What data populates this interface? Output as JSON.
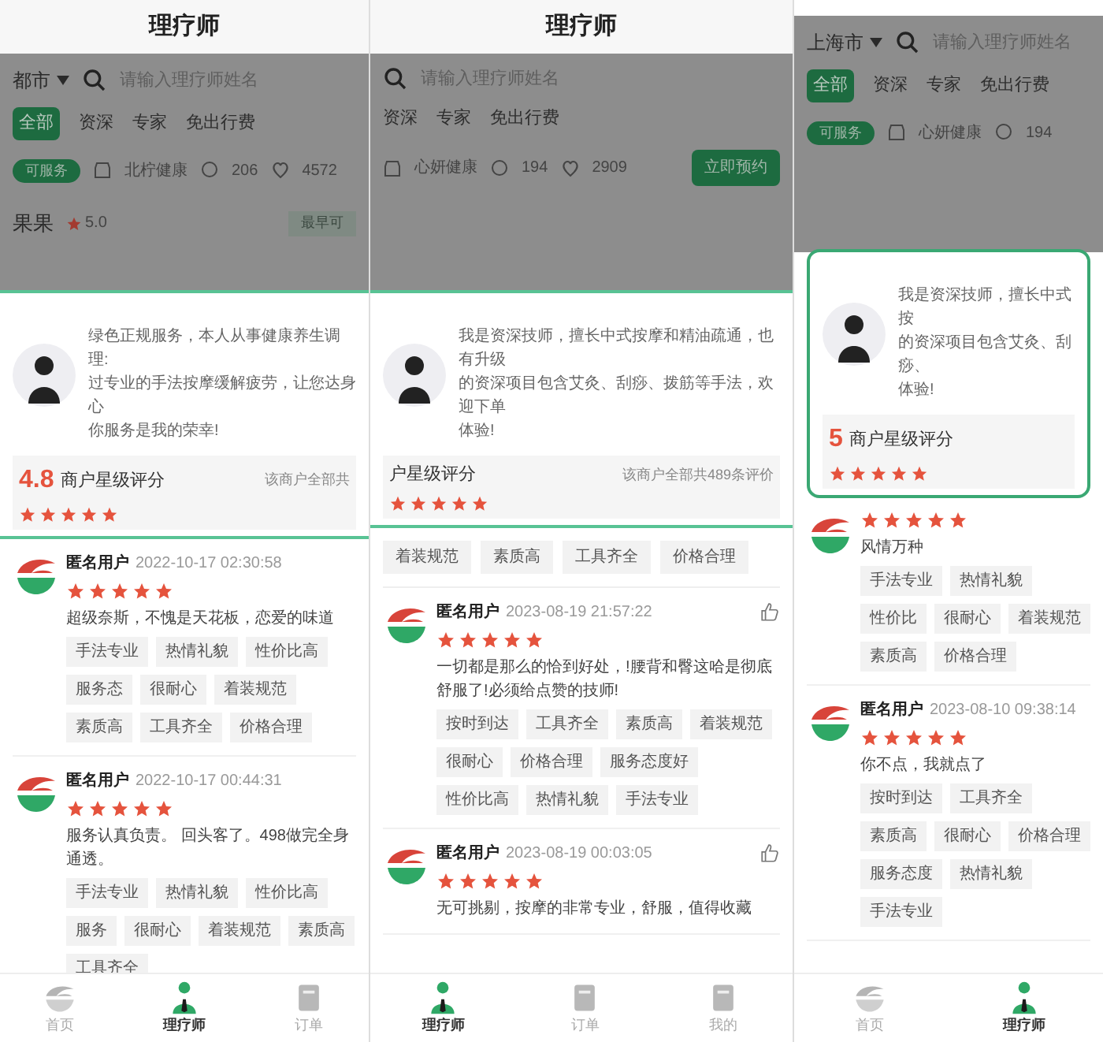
{
  "panels": [
    {
      "title": "理疗师",
      "city": "都市",
      "search": {
        "placeholder": "请输入理疗师姓名"
      },
      "tabs": [
        {
          "label": "全部",
          "selected": true
        },
        {
          "label": "资深",
          "selected": false
        },
        {
          "label": "专家",
          "selected": false
        },
        {
          "label": "免出行费",
          "selected": false
        }
      ],
      "listing": {
        "badge": "可服务",
        "shop": "北柠健康",
        "comments": "206",
        "likes": "4572",
        "name": "果果",
        "rating": "5.0",
        "tag": "最早可"
      },
      "profile": {
        "intro": [
          "绿色正规服务，本人从事健康养生调理:",
          "过专业的手法按摩缓解疲劳，让您达身心",
          "你服务是我的荣幸!"
        ],
        "score": "4.8",
        "score_label": "商户星级评分",
        "total": "该商户全部共",
        "stars": 5
      },
      "reviews": [
        {
          "user": "匿名用户",
          "time": "2022-10-17 02:30:58",
          "stars": 5,
          "text": "超级奈斯，不愧是天花板，恋爱的味道",
          "tags": [
            "手法专业",
            "热情礼貌",
            "性价比高",
            "服务态",
            "很耐心",
            "着装规范",
            "素质高",
            "工具齐全",
            "价格合理"
          ]
        },
        {
          "user": "匿名用户",
          "time": "2022-10-17 00:44:31",
          "stars": 5,
          "text": "服务认真负责。 回头客了。498做完全身通透。",
          "tags": [
            "手法专业",
            "热情礼貌",
            "性价比高",
            "服务",
            "很耐心",
            "着装规范",
            "素质高",
            "工具齐全"
          ]
        }
      ],
      "nav": [
        {
          "label": "首页",
          "selected": false
        },
        {
          "label": "理疗师",
          "selected": true
        },
        {
          "label": "订单",
          "selected": false
        }
      ]
    },
    {
      "title": "理疗师",
      "search": {
        "placeholder": "请输入理疗师姓名"
      },
      "tabs": [
        {
          "label": "资深",
          "selected": false
        },
        {
          "label": "专家",
          "selected": false
        },
        {
          "label": "免出行费",
          "selected": false
        }
      ],
      "listing": {
        "shop": "心妍健康",
        "comments": "194",
        "likes": "2909",
        "button": "立即预约"
      },
      "profile": {
        "intro": [
          "我是资深技师，擅长中式按摩和精油疏通，也有升级",
          "的资深项目包含艾灸、刮痧、拨筋等手法，欢迎下单",
          "体验!"
        ],
        "score_label": "户星级评分",
        "total": "该商户全部共489条评价",
        "stars": 5
      },
      "leading_tags": [
        "着装规范",
        "素质高",
        "工具齐全",
        "价格合理"
      ],
      "reviews": [
        {
          "user": "匿名用户",
          "time": "2023-08-19 21:57:22",
          "stars": 5,
          "like": true,
          "text": "一切都是那么的恰到好处，!腰背和臀这哈是彻底舒服了!必须给点赞的技师!",
          "tags": [
            "按时到达",
            "工具齐全",
            "素质高",
            "着装规范",
            "很耐心",
            "价格合理",
            "服务态度好",
            "性价比高",
            "热情礼貌",
            "手法专业"
          ]
        },
        {
          "user": "匿名用户",
          "time": "2023-08-19 00:03:05",
          "stars": 5,
          "like": true,
          "text": "无可挑剔，按摩的非常专业，舒服，值得收藏"
        }
      ],
      "nav": [
        {
          "label": "理疗师",
          "selected": true
        },
        {
          "label": "订单",
          "selected": false
        },
        {
          "label": "我的",
          "selected": false
        }
      ]
    },
    {
      "city": "上海市",
      "search": {
        "placeholder": "请输入理疗师姓名"
      },
      "tabs": [
        {
          "label": "全部",
          "selected": true
        },
        {
          "label": "资深",
          "selected": false
        },
        {
          "label": "专家",
          "selected": false
        },
        {
          "label": "免出行费",
          "selected": false
        }
      ],
      "listing": {
        "badge": "可服务",
        "shop": "心妍健康",
        "comments": "194"
      },
      "profile": {
        "intro": [
          "我是资深技师，擅长中式按",
          "的资深项目包含艾灸、刮痧、",
          "体验!"
        ],
        "score": "5",
        "score_label": "商户星级评分",
        "stars": 5
      },
      "reviews": [
        {
          "stars": 5,
          "text": "风情万种",
          "tags": [
            "手法专业",
            "热情礼貌",
            "性价比",
            "很耐心",
            "着装规范",
            "素质高",
            "价格合理"
          ]
        },
        {
          "user": "匿名用户",
          "time": "2023-08-10 09:38:14",
          "stars": 5,
          "text": "你不点，我就点了",
          "tags": [
            "按时到达",
            "工具齐全",
            "素质高",
            "很耐心",
            "价格合理",
            "服务态度",
            "热情礼貌",
            "手法专业"
          ]
        }
      ],
      "nav": [
        {
          "label": "首页",
          "selected": false
        },
        {
          "label": "理疗师",
          "selected": true
        }
      ]
    }
  ]
}
